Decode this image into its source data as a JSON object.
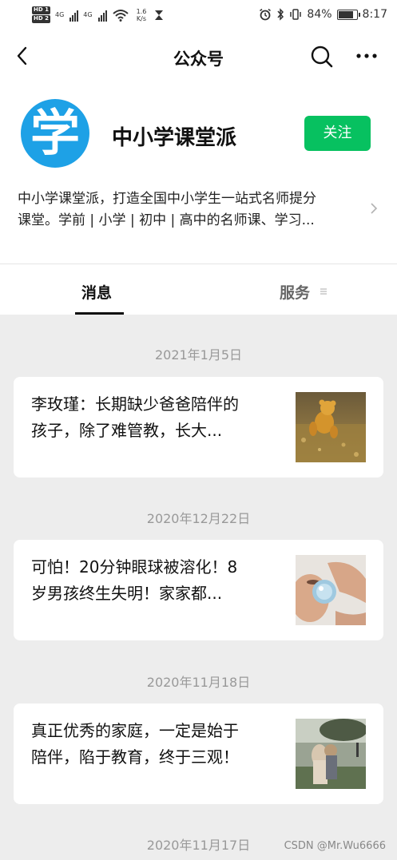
{
  "status_bar": {
    "hd1": "HD 1",
    "hd2": "HD 2",
    "net1": "4G",
    "net2": "4G",
    "speed_value": "1.6",
    "speed_unit": "K/s",
    "battery_percent": "84%",
    "battery_level": 0.84,
    "time": "8:17"
  },
  "nav": {
    "title": "公众号"
  },
  "profile": {
    "avatar_glyph": "学",
    "name": "中小学课堂派",
    "follow_label": "关注",
    "intro_line1": "中小学课堂派，打造全国中小学生一站式名师提分",
    "intro_line2": "课堂。学前 | 小学 | 初中 | 高中的名师课、学习..."
  },
  "tabs": {
    "messages": "消息",
    "services": "服务"
  },
  "feed": [
    {
      "date": "2021年1月5日",
      "title_line1": "李玫瑾：长期缺少爸爸陪伴的",
      "title_line2": "孩子，除了难管教，长大..."
    },
    {
      "date": "2020年12月22日",
      "title_line1": "可怕！20分钟眼球被溶化！8",
      "title_line2": "岁男孩终生失明！家家都..."
    },
    {
      "date": "2020年11月18日",
      "title_line1": "真正优秀的家庭，一定是始于",
      "title_line2": "陪伴，陷于教育，终于三观！"
    },
    {
      "date": "2020年11月17日"
    }
  ],
  "watermark": "CSDN @Mr.Wu6666",
  "colors": {
    "follow_green": "#07c160",
    "avatar_blue": "#1ea1e6",
    "background_gray": "#ededed"
  }
}
